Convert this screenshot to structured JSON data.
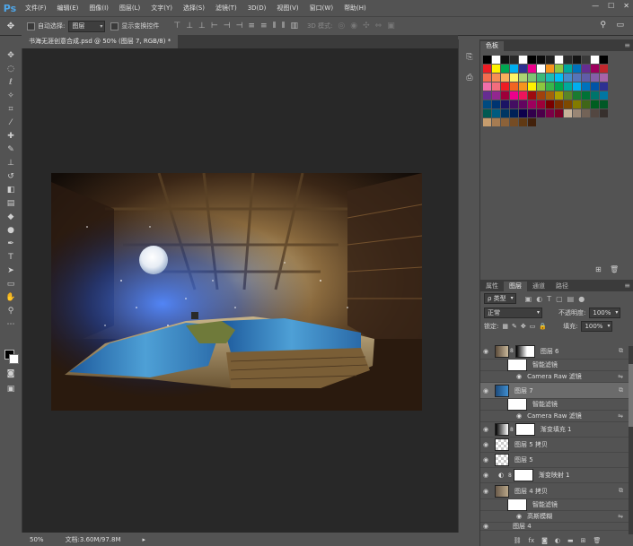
{
  "menu": {
    "logo": "Ps",
    "items": [
      "文件(F)",
      "编辑(E)",
      "图像(I)",
      "图层(L)",
      "文字(Y)",
      "选择(S)",
      "滤镜(T)",
      "3D(D)",
      "视图(V)",
      "窗口(W)",
      "帮助(H)"
    ],
    "window_controls": [
      "—",
      "☐",
      "✕"
    ]
  },
  "options": {
    "auto_select_label": "自动选择:",
    "auto_select_value": "图层",
    "show_transform_label": "显示变换控件",
    "mode_3d_label": "3D 模式:"
  },
  "document": {
    "tab_title": "书海无涯创意合成.psd @ 50% (图层 7, RGB/8) *",
    "zoom": "50%",
    "doc_info": "文档:3.60M/97.8M"
  },
  "swatches_panel": {
    "tab": "色板",
    "colors": [
      "#000000",
      "#ffffff",
      "#111111",
      "#2a2a2a",
      "#ffffff",
      "#000000",
      "#0b0b0b",
      "#1f1f1f",
      "#ffffff",
      "#2b2b2b",
      "#151515",
      "#3a3a3a",
      "#ffffff",
      "#000000",
      "#ed1c24",
      "#fff200",
      "#00a651",
      "#00aeef",
      "#2e3192",
      "#ec008c",
      "#ffffff",
      "#f7941d",
      "#8dc63f",
      "#00a99d",
      "#0072bc",
      "#662d91",
      "#9e005d",
      "#c1272d",
      "#f26c4f",
      "#f68e55",
      "#fbaf5c",
      "#fff467",
      "#acd372",
      "#7dc473",
      "#3cb878",
      "#1cbbb4",
      "#00bff3",
      "#448ccb",
      "#5674b9",
      "#605ca8",
      "#855fa8",
      "#a763a8",
      "#f06ea9",
      "#f26d7d",
      "#ed1c24",
      "#f26522",
      "#f7941d",
      "#fff200",
      "#8dc73f",
      "#39b54a",
      "#00a651",
      "#00a99d",
      "#00aeef",
      "#0072bc",
      "#0054a6",
      "#2e3192",
      "#662d91",
      "#92278f",
      "#9e0039",
      "#ec008c",
      "#ed145b",
      "#9e0b0f",
      "#a0410d",
      "#a3620a",
      "#aba000",
      "#598527",
      "#1a7b30",
      "#007236",
      "#00746b",
      "#0076a3",
      "#004a80",
      "#003471",
      "#1b1464",
      "#440e62",
      "#630460",
      "#9e005d",
      "#9e0039",
      "#790000",
      "#7b2e00",
      "#7d4900",
      "#827b00",
      "#406618",
      "#005e20",
      "#005826",
      "#005952",
      "#005b7f",
      "#003663",
      "#002157",
      "#0d004c",
      "#32004b",
      "#4b0049",
      "#7b0046",
      "#7a0026",
      "#c7b299",
      "#998675",
      "#736357",
      "#534741",
      "#37302d",
      "#c69c6d",
      "#a67c52",
      "#8c6239",
      "#754c24",
      "#603913",
      "#42210b"
    ]
  },
  "layers_panel": {
    "tabs": [
      "属性",
      "图层",
      "通道",
      "路径"
    ],
    "active_tab": "图层",
    "filter_kind": "ρ 类型",
    "blend_mode": "正常",
    "opacity_label": "不透明度:",
    "opacity_value": "100%",
    "lock_label": "锁定:",
    "fill_label": "填充:",
    "fill_value": "100%",
    "layers": [
      {
        "name": "图层 6",
        "kind": "photo-mask",
        "selected": false
      },
      {
        "name": "智能滤镜",
        "kind": "smart-filter"
      },
      {
        "name": "Camera Raw 滤镜",
        "kind": "filter"
      },
      {
        "name": "图层 7",
        "kind": "photo",
        "selected": true
      },
      {
        "name": "智能滤镜",
        "kind": "smart-filter"
      },
      {
        "name": "Camera Raw 滤镜",
        "kind": "filter"
      },
      {
        "name": "渐变填充 1",
        "kind": "gradient-mask"
      },
      {
        "name": "图层 5 拷贝",
        "kind": "checker"
      },
      {
        "name": "图层 5",
        "kind": "checker"
      },
      {
        "name": "渐变映射 1",
        "kind": "adjust-mask"
      },
      {
        "name": "图层 4 拷贝",
        "kind": "photo"
      },
      {
        "name": "智能滤镜",
        "kind": "smart-filter"
      },
      {
        "name": "高斯模糊",
        "kind": "filter"
      },
      {
        "name": "图层 4",
        "kind": "photo"
      }
    ],
    "footer_icons": [
      "链接",
      "fx",
      "蒙版",
      "调整",
      "组",
      "新建",
      "删除"
    ]
  }
}
